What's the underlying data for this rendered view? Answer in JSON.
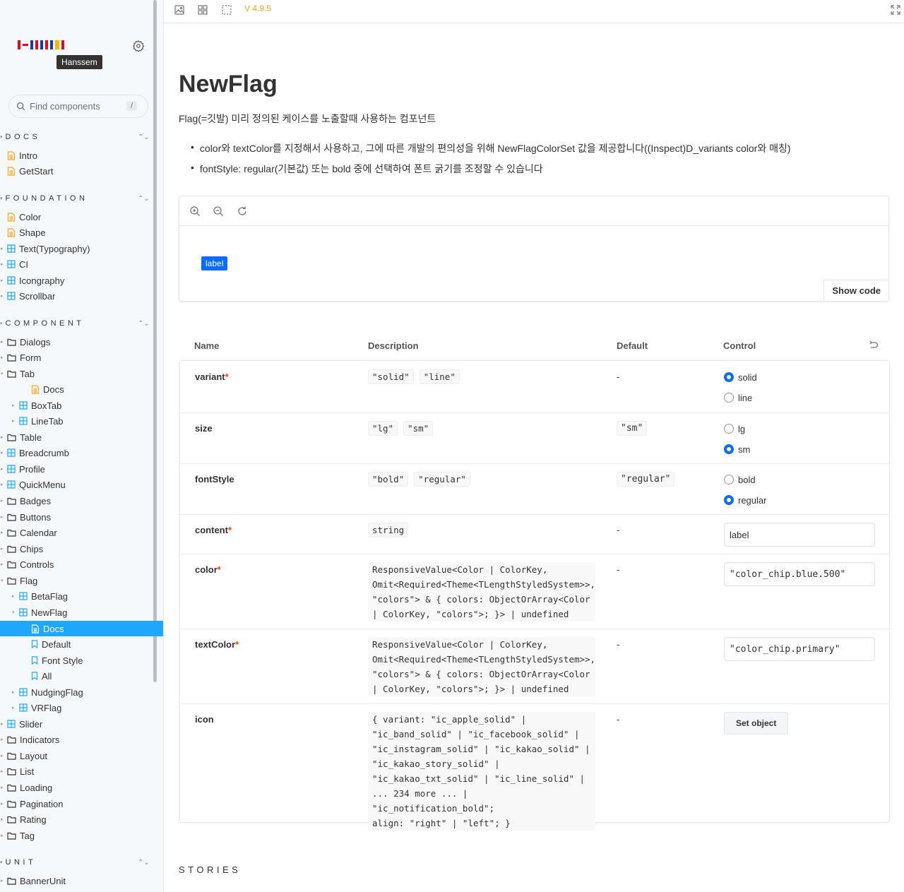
{
  "sidebar": {
    "brand_tooltip": "Hanssem",
    "search_placeholder": "Find components",
    "search_shortcut": "/",
    "sections": {
      "docs": "DOCS",
      "foundation": "FOUNDATION",
      "component": "COMPONENT",
      "unit": "UNIT"
    },
    "docs_items": [
      "Intro",
      "GetStart"
    ],
    "foundation_items": [
      "Color",
      "Shape",
      "Text(Typography)",
      "CI",
      "Icongraphy",
      "Scrollbar"
    ],
    "component_items": [
      "Dialogs",
      "Form",
      "Tab",
      "Docs",
      "BoxTab",
      "LineTab",
      "Table",
      "Breadcrumb",
      "Profile",
      "QuickMenu",
      "Badges",
      "Buttons",
      "Calendar",
      "Chips",
      "Controls",
      "Flag",
      "BetaFlag",
      "NewFlag",
      "Docs",
      "Default",
      "Font Style",
      "All",
      "NudgingFlag",
      "VRFlag",
      "Slider",
      "Indicators",
      "Layout",
      "List",
      "Loading",
      "Pagination",
      "Rating",
      "Tag"
    ],
    "unit_items": [
      "BannerUnit"
    ]
  },
  "toolbar": {
    "version": "V 4.9.5"
  },
  "page": {
    "title": "NewFlag",
    "intro": "Flag(=깃발) 미리 정의된 케이스를 노출할때 사용하는 컴포넌트",
    "bullets": [
      "color와 textColor를 지정해서 사용하고, 그에 따른 개발의 편의성을 위해 NewFlagColorSet 값을 제공합니다((Inspect)D_variants color와 매칭)",
      "fontStyle: regular(기본값) 또는 bold 중에 선택하여 폰트 굵기를 조정할 수 있습니다"
    ],
    "preview_flag": "label",
    "show_code": "Show code",
    "stories_heading": "STORIES"
  },
  "args_table": {
    "headers": {
      "name": "Name",
      "description": "Description",
      "default": "Default",
      "control": "Control"
    },
    "rows": {
      "variant": {
        "name": "variant",
        "chips": [
          "\"solid\"",
          "\"line\""
        ],
        "default": "-",
        "options": [
          "solid",
          "line"
        ]
      },
      "size": {
        "name": "size",
        "chips": [
          "\"lg\"",
          "\"sm\""
        ],
        "default": "\"sm\"",
        "options": [
          "lg",
          "sm"
        ]
      },
      "fontStyle": {
        "name": "fontStyle",
        "chips": [
          "\"bold\"",
          "\"regular\""
        ],
        "default": "\"regular\"",
        "options": [
          "bold",
          "regular"
        ]
      },
      "content": {
        "name": "content",
        "chips": [
          "string"
        ],
        "default": "-",
        "value": "label"
      },
      "color": {
        "name": "color",
        "lines": [
          "ResponsiveValue<Color | ColorKey,",
          "Omit<Required<Theme<TLengthStyledSystem>>,",
          "\"colors\"> & { colors: ObjectOrArray<Color",
          "| ColorKey, \"colors\">; }> | undefined"
        ],
        "default": "-",
        "value": "\"color_chip.blue.500\""
      },
      "textColor": {
        "name": "textColor",
        "lines": [
          "ResponsiveValue<Color | ColorKey,",
          "Omit<Required<Theme<TLengthStyledSystem>>,",
          "\"colors\"> & { colors: ObjectOrArray<Color",
          "| ColorKey, \"colors\">; }> | undefined"
        ],
        "default": "-",
        "value": "\"color_chip.primary\""
      },
      "icon": {
        "name": "icon",
        "lines": [
          "{ variant: \"ic_apple_solid\" |",
          "\"ic_band_solid\" | \"ic_facebook_solid\" |",
          "\"ic_instagram_solid\" | \"ic_kakao_solid\" |",
          "\"ic_kakao_story_solid\" |",
          "\"ic_kakao_txt_solid\" | \"ic_line_solid\" |",
          "... 234 more ... | \"ic_notification_bold\";",
          "align: \"right\" | \"left\"; }"
        ],
        "default": "-",
        "button": "Set object"
      }
    }
  },
  "colors": {
    "accent": "#1ea7fd",
    "flag_blue": "#0b6cff",
    "version": "#f5a623",
    "required": "#ff4400"
  }
}
